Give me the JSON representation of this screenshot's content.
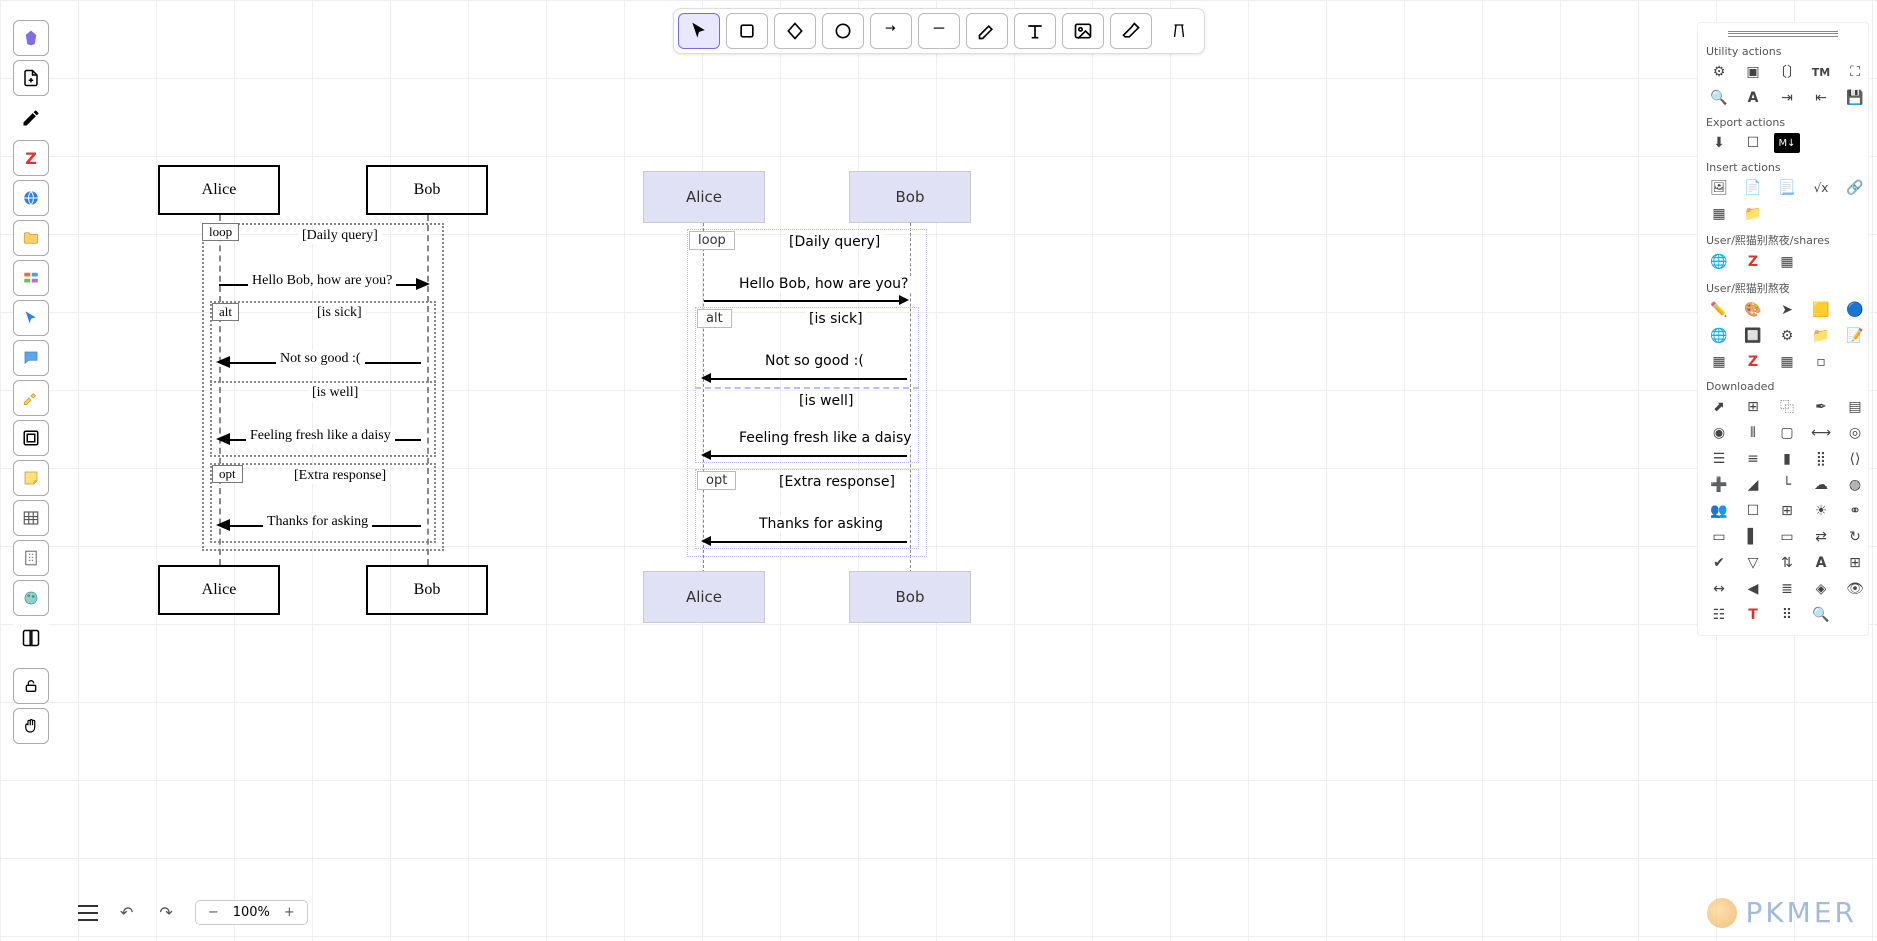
{
  "top_tools": {
    "selection": "selection",
    "rectangle": "rectangle",
    "diamond": "diamond",
    "ellipse": "ellipse",
    "arrow": "arrow",
    "line": "line",
    "draw": "draw",
    "text": "text",
    "image": "image",
    "eraser": "eraser",
    "extra": "extra"
  },
  "zoom": {
    "minus": "−",
    "value": "100%",
    "plus": "+"
  },
  "right": {
    "utility_label": "Utility actions",
    "export_label": "Export actions",
    "insert_label": "Insert actions",
    "user_shares_label": "User/熙猫别熬夜/shares",
    "user_label": "User/熙猫别熬夜",
    "downloaded_label": "Downloaded"
  },
  "sketch": {
    "actors": {
      "alice": "Alice",
      "bob": "Bob"
    },
    "fragments": {
      "loop": "loop",
      "alt": "alt",
      "opt": "opt"
    },
    "guards": {
      "daily": "[Daily query]",
      "sick": "[is sick]",
      "well": "[is well]",
      "extra": "[Extra response]"
    },
    "messages": {
      "hello": "Hello Bob, how are you?",
      "not_good": "Not so good :(",
      "fresh": "Feeling fresh like a daisy",
      "thanks": "Thanks for asking"
    }
  },
  "clean": {
    "actors": {
      "alice": "Alice",
      "bob": "Bob"
    },
    "fragments": {
      "loop": "loop",
      "alt": "alt",
      "opt": "opt"
    },
    "guards": {
      "daily": "[Daily query]",
      "sick": "[is sick]",
      "well": "[is well]",
      "extra": "[Extra response]"
    },
    "messages": {
      "hello": "Hello Bob, how are you?",
      "not_good": "Not so good :(",
      "fresh": "Feeling fresh like a daisy",
      "thanks": "Thanks for asking"
    }
  },
  "watermark": "PKMER"
}
